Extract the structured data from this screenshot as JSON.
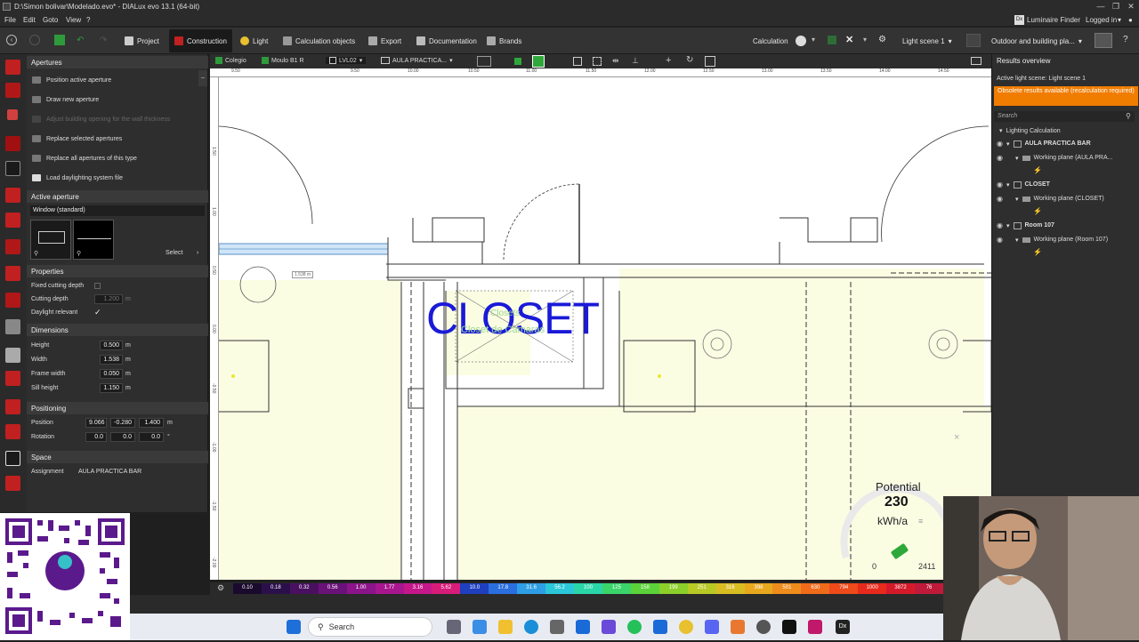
{
  "window": {
    "title": "D:\\Simon bolivar\\Modelado.evo* - DIALux evo 13.1  (64-bit)"
  },
  "menu": [
    "File",
    "Edit",
    "Goto",
    "View",
    "?"
  ],
  "top_right": {
    "luminaire_finder": "Luminaire Finder",
    "logged_in": "Logged in"
  },
  "toolbar": {
    "tabs": [
      "Project",
      "Construction",
      "Light",
      "Calculation objects",
      "Export",
      "Documentation",
      "Brands"
    ],
    "active": "Construction",
    "calculation": "Calculation",
    "light_scene": "Light scene 1",
    "outdoor": "Outdoor and building pla..."
  },
  "left_panel": {
    "header": "Apertures",
    "items": [
      "Position active aperture",
      "Draw new aperture",
      "Adjust building opening for the wall thickness",
      "Replace selected apertures",
      "Replace all apertures of this type",
      "Load daylighting system file"
    ],
    "active_aperture_header": "Active aperture",
    "window_type": "Window (standard)",
    "select_label": "Select",
    "properties_header": "Properties",
    "fixed_cutting_depth": "Fixed cutting depth",
    "cutting_depth": "Cutting depth",
    "cutting_depth_value": "1.200",
    "daylight_relevant": "Daylight relevant",
    "dimensions_header": "Dimensions",
    "height_label": "Height",
    "height": "0.500",
    "width_label": "Width",
    "width": "1.538",
    "frame_width_label": "Frame width",
    "frame_width": "0.050",
    "sill_height_label": "Sill height",
    "sill_height": "1.150",
    "unit_m": "m",
    "positioning_header": "Positioning",
    "position_label": "Position",
    "pos_x": "9.066",
    "pos_y": "-0.280",
    "pos_z": "1.400",
    "rotation_label": "Rotation",
    "rot_x": "0.0",
    "rot_y": "0.0",
    "rot_z": "0.0",
    "rotation_unit": "°",
    "space_header": "Space",
    "assignment_label": "Assignment",
    "assignment": "AULA PRACTICA BAR"
  },
  "view_tabs": {
    "building": "Colegio",
    "storey": "Moulo B1 R",
    "level": "LVL02",
    "room": "AULA PRACTICA..."
  },
  "canvas": {
    "closet_label": "CLOSET",
    "closet_sub1": "Closets",
    "closet_sub2": "Closet de Camaras",
    "dim_label": "1.538 m",
    "potential_label": "Potential",
    "potential_value": "230",
    "potential_unit": "kWh/a",
    "gauge_min": "0",
    "gauge_max": "2411",
    "ruler_top_ticks": [
      "9.50",
      "9.50",
      "10.00",
      "10.50",
      "11.00",
      "11.50",
      "12.00",
      "12.50",
      "13.00",
      "13.50",
      "14.00",
      "14.50"
    ],
    "ruler_left_ticks": [
      "1.50",
      "1.00",
      "0.50",
      "0.00",
      "-0.50",
      "-1.00",
      "-1.50",
      "-2.00",
      "-2.50"
    ]
  },
  "legend": {
    "values": [
      "0.10",
      "0.18",
      "0.32",
      "0.56",
      "1.00",
      "1.77",
      "3.16",
      "5.62",
      "10.0",
      "17.8",
      "31.6",
      "56.2",
      "100",
      "125",
      "158",
      "199",
      "251",
      "316",
      "398",
      "501",
      "630",
      "794",
      "1000",
      "3872",
      "76"
    ],
    "colors": [
      "#1a0a2e",
      "#2b0f4a",
      "#4a1060",
      "#6a1278",
      "#8b148a",
      "#a8168e",
      "#c4188a",
      "#d81c7a",
      "#1f3fbf",
      "#2a6ee0",
      "#2e9fe6",
      "#2bc7d8",
      "#2ad6a8",
      "#3ad46a",
      "#5bd23a",
      "#8ccf2a",
      "#b8c926",
      "#d8bd22",
      "#e8a81e",
      "#ee8c1c",
      "#f06c1a",
      "#ee4a1a",
      "#e82a1c",
      "#d41a2a",
      "#c01a3a"
    ]
  },
  "right_panel": {
    "header": "Results overview",
    "scene": "Active light scene: Light scene 1",
    "warning": "Obsolete results available (recalculation required)",
    "search_placeholder": "Search",
    "lighting_calc": "Lighting Calculation",
    "items": [
      {
        "name": "AULA PRACTICA BAR",
        "bold": true,
        "indent": 0
      },
      {
        "name": "Working plane (AULA PRA...",
        "bold": false,
        "indent": 1
      },
      {
        "name": "CLOSET",
        "bold": true,
        "indent": 0
      },
      {
        "name": "Working plane (CLOSET)",
        "bold": false,
        "indent": 1
      },
      {
        "name": "Room 107",
        "bold": true,
        "indent": 0
      },
      {
        "name": "Working plane (Room 107)",
        "bold": false,
        "indent": 1
      }
    ]
  },
  "taskbar": {
    "search": "Search"
  },
  "colors": {
    "accent_orange": "#f07c00",
    "room_fill": "#fbfde3",
    "closet_blue": "#1a1ad8",
    "closet_green": "#9bd890"
  }
}
